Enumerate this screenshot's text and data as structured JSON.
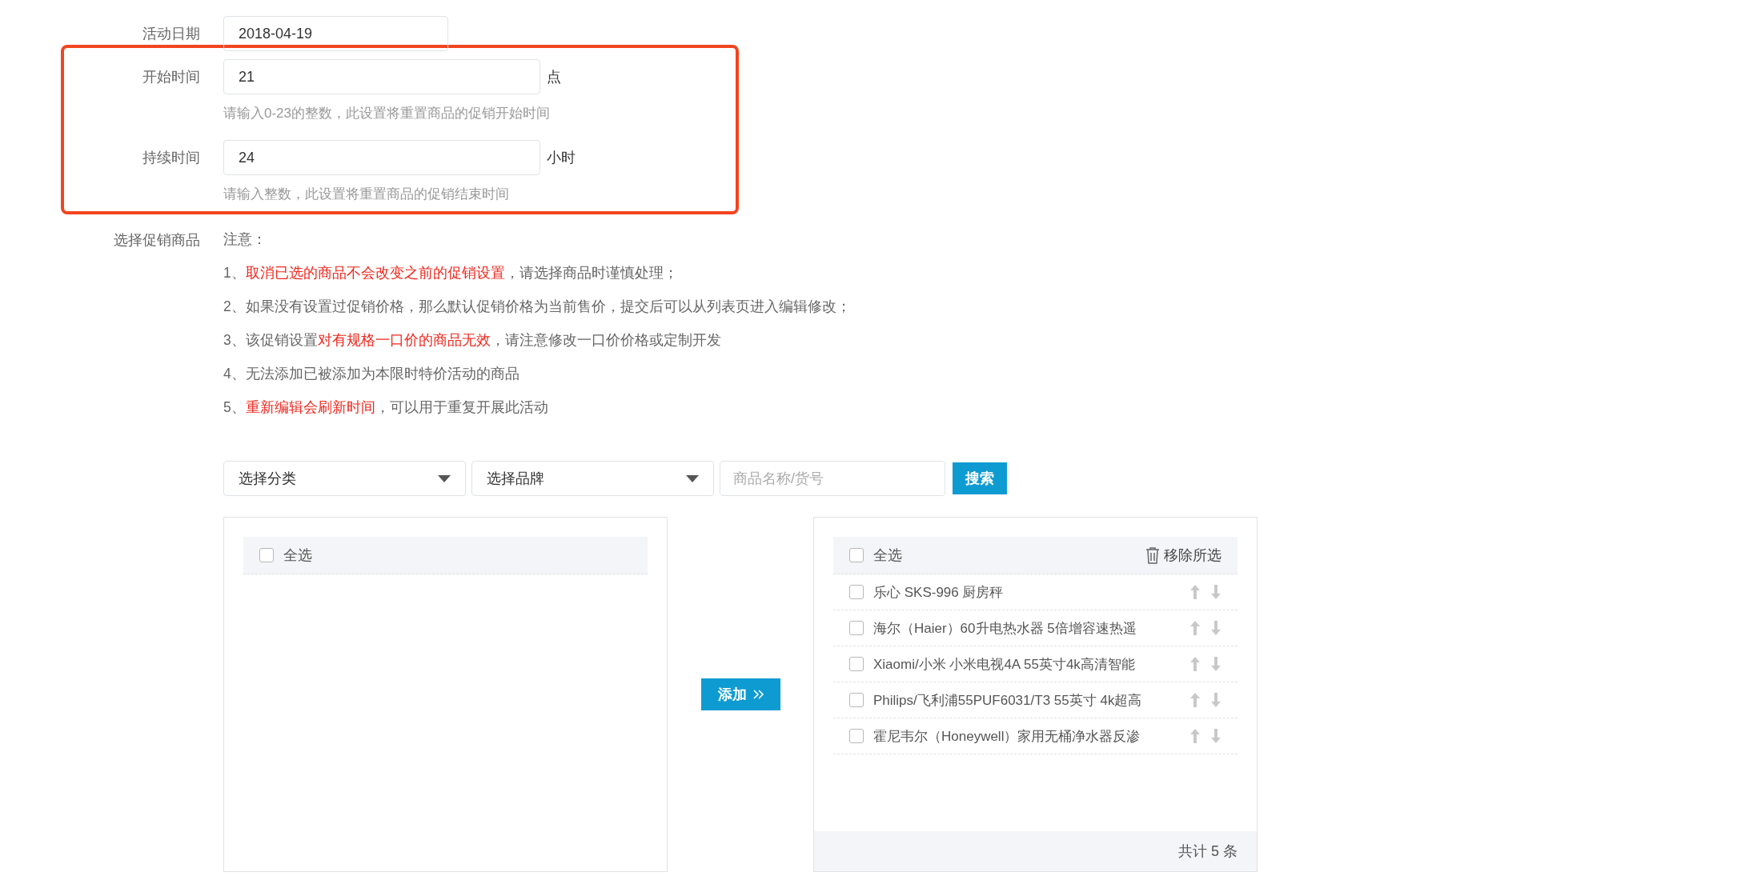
{
  "date_field": {
    "label": "活动日期",
    "value": "2018-04-19"
  },
  "highlighted_fields": [
    {
      "label": "开始时间",
      "value": "21",
      "unit": "点",
      "hint": "请输入0-23的整数，此设置将重置商品的促销开始时间"
    },
    {
      "label": "持续时间",
      "value": "24",
      "unit": "小时",
      "hint": "请输入整数，此设置将重置商品的促销结束时间"
    }
  ],
  "goods_section": {
    "label": "选择促销商品",
    "notes_title": "注意：",
    "notes": [
      {
        "segments": [
          {
            "text": "1、",
            "highlight": false
          },
          {
            "text": "取消已选的商品不会改变之前的促销设置",
            "highlight": true
          },
          {
            "text": "，请选择商品时谨慎处理；",
            "highlight": false
          }
        ]
      },
      {
        "segments": [
          {
            "text": "2、如果没有设置过促销价格，那么默认促销价格为当前售价，提交后可以从列表页进入编辑修改；",
            "highlight": false
          }
        ]
      },
      {
        "segments": [
          {
            "text": "3、该促销设置",
            "highlight": false
          },
          {
            "text": "对有规格一口价的商品无效",
            "highlight": true
          },
          {
            "text": "，请注意修改一口价价格或定制开发",
            "highlight": false
          }
        ]
      },
      {
        "segments": [
          {
            "text": "4、无法添加已被添加为本限时特价活动的商品",
            "highlight": false
          }
        ]
      },
      {
        "segments": [
          {
            "text": "5、",
            "highlight": false
          },
          {
            "text": "重新编辑会刷新时间",
            "highlight": true
          },
          {
            "text": "，可以用于重复开展此活动",
            "highlight": false
          }
        ]
      }
    ]
  },
  "toolbar": {
    "category_select": "选择分类",
    "brand_select": "选择品牌",
    "search": {
      "placeholder": "商品名称/货号"
    },
    "search_button": "搜索"
  },
  "source_panel": {
    "select_all": {
      "label": "全选",
      "checked": false
    }
  },
  "add_button": "添加",
  "selected_panel": {
    "select_all": {
      "label": "全选",
      "checked": false
    },
    "remove_button": "移除所选",
    "items": [
      {
        "name": "乐心 SKS-996 厨房秤",
        "checked": false
      },
      {
        "name": "海尔（Haier）60升电热水器 5倍增容速热遥",
        "checked": false
      },
      {
        "name": "Xiaomi/小米 小米电视4A 55英寸4k高清智能",
        "checked": false
      },
      {
        "name": "Philips/飞利浦55PUF6031/T3 55英寸 4k超高",
        "checked": false
      },
      {
        "name": "霍尼韦尔（Honeywell）家用无桶净水器反渗",
        "checked": false
      }
    ],
    "total": "共计 5 条"
  }
}
